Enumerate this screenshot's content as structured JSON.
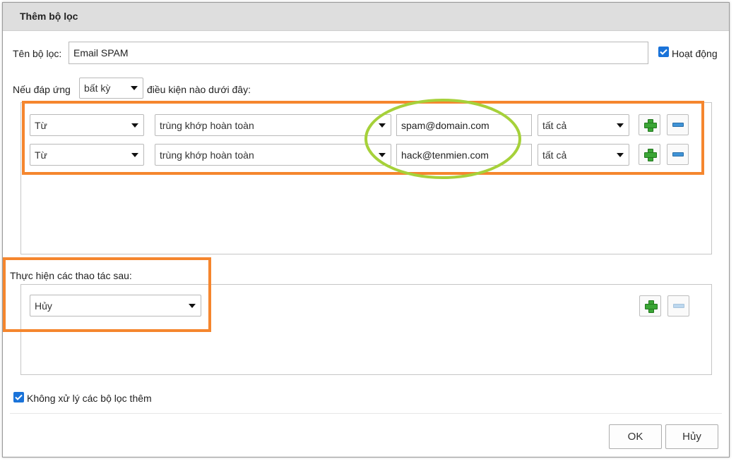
{
  "dialog": {
    "title": "Thêm bộ lọc",
    "filter_name_label": "Tên bộ lọc:",
    "filter_name_value": "Email SPAM",
    "active_label": "Hoạt động",
    "active_checked": true,
    "match_prefix": "Nếu đáp ứng",
    "match_mode": "bất kỳ",
    "match_suffix": "điều kiện nào dưới đây:",
    "conditions": [
      {
        "field": "Từ",
        "operator": "trùng khớp hoàn toàn",
        "value": "spam@domain.com",
        "scope": "tất cả"
      },
      {
        "field": "Từ",
        "operator": "trùng khớp hoàn toàn",
        "value": "hack@tenmien.com",
        "scope": "tất cả"
      }
    ],
    "actions_label": "Thực hiện các thao tác sau:",
    "action_value": "Hủy",
    "stop_label": "Không xử lý các bộ lọc thêm",
    "stop_checked": true,
    "ok_label": "OK",
    "cancel_label": "Hủy"
  },
  "icons": {
    "add": "plus-icon",
    "remove": "minus-icon",
    "dropdown": "chevron-down-icon",
    "check": "check-icon"
  },
  "colors": {
    "highlight_orange": "#f5862e",
    "highlight_green": "#a6d13a",
    "checkbox_blue": "#1a73d9",
    "add_green": "#3aa535",
    "remove_blue": "#3f93d6"
  }
}
